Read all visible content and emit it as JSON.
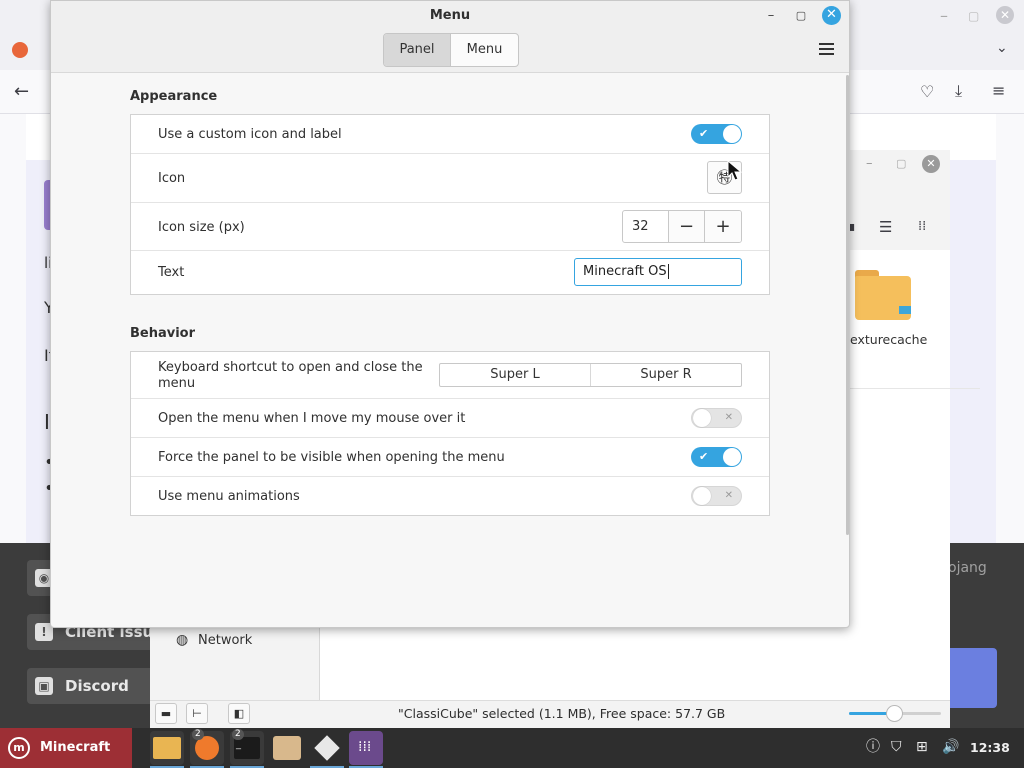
{
  "dialog": {
    "title": "Menu",
    "tabs": [
      "Panel",
      "Menu"
    ],
    "active_tab": "Panel",
    "appearance": {
      "title": "Appearance",
      "custom_icon_label": "Use a custom icon and label",
      "custom_icon_enabled": true,
      "icon_label": "Icon",
      "icon_glyph": "linux-mint-logo-icon",
      "icon_size_label": "Icon size (px)",
      "icon_size_value": "32",
      "text_label": "Text",
      "text_value": "Minecraft OS"
    },
    "behavior": {
      "title": "Behavior",
      "shortcut_label": "Keyboard shortcut to open and close the menu",
      "shortcut_primary": "Super L",
      "shortcut_secondary": "Super R",
      "hover_label": "Open the menu when I move my mouse over it",
      "hover_enabled": false,
      "force_panel_label": "Force the panel to be visible when opening the menu",
      "force_panel_enabled": true,
      "animations_label": "Use menu animations",
      "animations_enabled": false
    }
  },
  "file_manager": {
    "folder_label": "exturecache",
    "sidebar_network": "Network",
    "status": "\"ClassiCube\" selected (1.1 MB), Free space: 57.7 GB"
  },
  "web_page": {
    "fragments": [
      "li",
      "Y",
      "It",
      "I"
    ],
    "buttons": [
      "",
      "Client issu",
      "Discord"
    ],
    "right_text": "ojang"
  },
  "taskbar": {
    "start_label": "Minecraft OS",
    "badges": [
      "2",
      "2"
    ],
    "clock": "12:38"
  },
  "colors": {
    "accent": "#35a4e0",
    "start_button": "#9d2f35",
    "taskbar": "#2e2e2e"
  }
}
